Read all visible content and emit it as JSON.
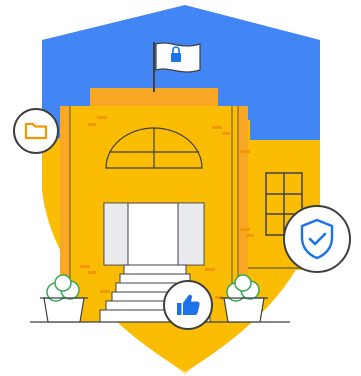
{
  "illustration": {
    "colors": {
      "shield_blue": "#4285f4",
      "shield_yellow": "#fbbc04",
      "building_yellow": "#fbbc04",
      "building_shadow": "#f9a825",
      "pale_yellow": "#fde6a0",
      "outline": "#3c4043",
      "accent_blue": "#1a73e8",
      "brick": "#f29900"
    },
    "icons": [
      "lock-icon",
      "folder-icon",
      "shield-check-icon",
      "thumbs-up-icon",
      "plant-icon"
    ]
  }
}
